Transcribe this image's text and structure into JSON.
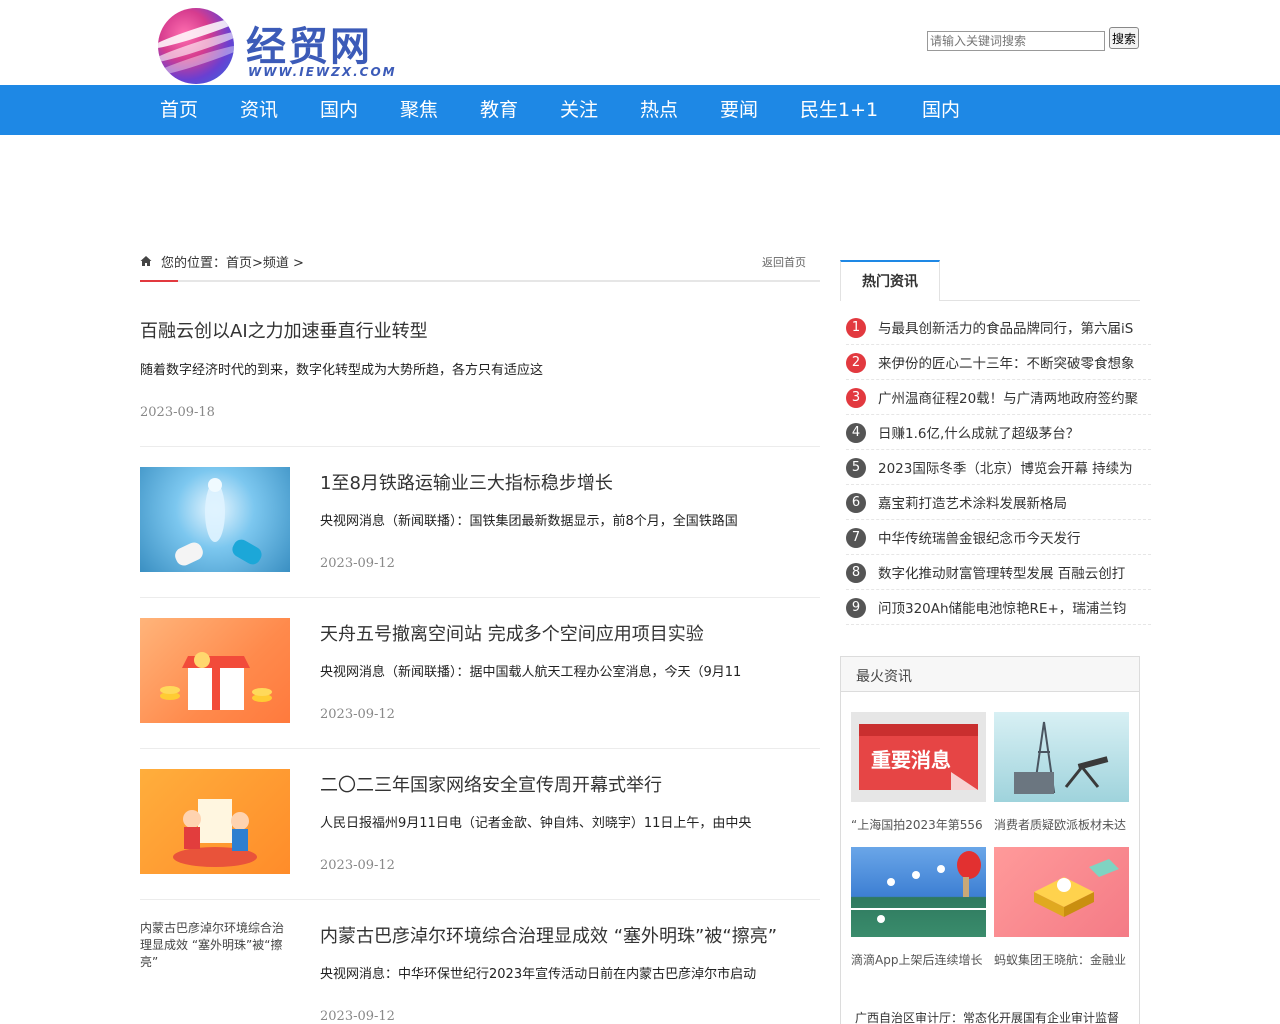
{
  "site": {
    "logo_text": "经贸网",
    "logo_sub": "WWW.IEWZX.COM"
  },
  "search": {
    "placeholder": "请输入关键词搜索",
    "button": "搜索"
  },
  "nav": [
    "首页",
    "资讯",
    "国内",
    "聚焦",
    "教育",
    "关注",
    "热点",
    "要闻",
    "民生1+1",
    "国内"
  ],
  "breadcrumb": {
    "text": "您的位置：首页>频道 >",
    "back": "返回首页"
  },
  "articles": [
    {
      "title": "百融云创以AI之力加速垂直行业转型",
      "desc": "随着数字经济时代的到来，数字化转型成为大势所趋，各方只有适应这",
      "date": "2023-09-18"
    },
    {
      "title": "1至8月铁路运输业三大指标稳步增长",
      "desc": "央视网消息（新闻联播）：国铁集团最新数据显示，前8个月，全国铁路国",
      "date": "2023-09-12",
      "image": "medical-figure-capsule"
    },
    {
      "title": "天舟五号撤离空间站 完成多个空间应用项目实验",
      "desc": "央视网消息（新闻联播）：据中国载人航天工程办公室消息，今天（9月11",
      "date": "2023-09-12",
      "image": "gift-box-coins"
    },
    {
      "title": "二〇二三年国家网络安全宣传周开幕式举行",
      "desc": "人民日报福州9月11日电（记者金歆、钟自炜、刘晓宇）11日上午，由中央",
      "date": "2023-09-12",
      "image": "kids-reading"
    },
    {
      "title": "内蒙古巴彦淖尔环境综合治理显成效 “塞外明珠”被“擦亮”",
      "desc": "央视网消息：中华环保世纪行2023年宣传活动日前在内蒙古巴彦淖尔市启动",
      "date": "2023-09-12",
      "thumb_text": "内蒙古巴彦淖尔环境综合治理显成效 “塞外明珠”被“擦亮”"
    }
  ],
  "hot": {
    "tab": "热门资讯",
    "items": [
      {
        "num": "1",
        "text": "与最具创新活力的食品品牌同行，第六届iS"
      },
      {
        "num": "2",
        "text": "来伊份的匠心二十三年：不断突破零食想象"
      },
      {
        "num": "3",
        "text": "广州温商征程20载！与广清两地政府签约聚"
      },
      {
        "num": "4",
        "text": "日赚1.6亿,什么成就了超级茅台？"
      },
      {
        "num": "5",
        "text": "2023国际冬季（北京）博览会开幕 持续为"
      },
      {
        "num": "6",
        "text": "嘉宝莉打造艺术涂料发展新格局"
      },
      {
        "num": "7",
        "text": "中华传统瑞兽金银纪念币今天发行"
      },
      {
        "num": "8",
        "text": "数字化推动财富管理转型发展 百融云创打"
      },
      {
        "num": "9",
        "text": "问顶320Ah储能电池惊艳RE+，瑞浦兰钧"
      }
    ],
    "colors": {
      "top": "#e2393f",
      "rest": "#555555"
    }
  },
  "hottest": {
    "title": "最火资讯",
    "cards": [
      {
        "caption": "“上海国拍2023年第556",
        "image": "important-news-calendar",
        "img_text": "重要消息"
      },
      {
        "caption": "消费者质疑欧派板材未达",
        "image": "oil-industry"
      },
      {
        "caption": "滴滴App上架后连续增长",
        "image": "ping-pong"
      },
      {
        "caption": "蚂蚁集团王晓航：金融业",
        "image": "isometric-finance"
      }
    ],
    "link": "广西自治区审计厅：常态化开展国有企业审计监督"
  },
  "colors": {
    "nav": "#1e88e5",
    "accent_red": "#e2393f"
  }
}
